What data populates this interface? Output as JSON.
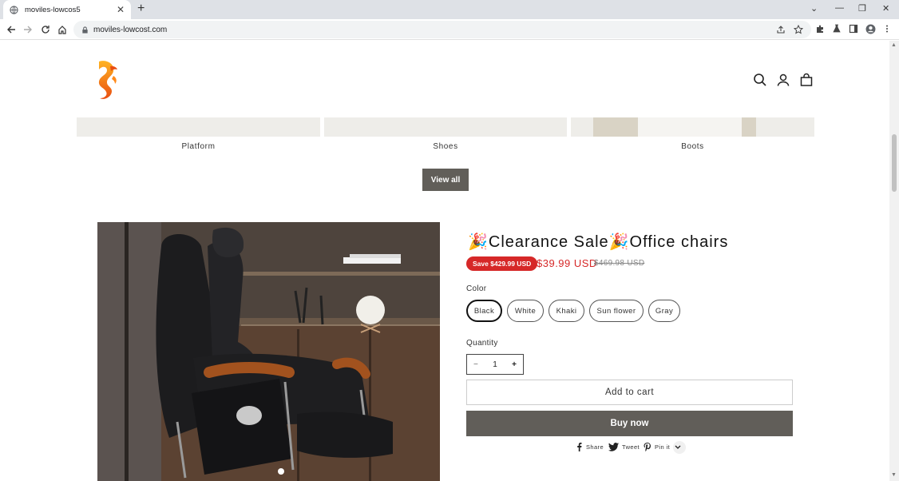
{
  "browser": {
    "tab_title": "moviles-lowcos5",
    "url": "moviles-lowcost.com"
  },
  "header": {
    "icons": [
      "search-icon",
      "account-icon",
      "cart-icon"
    ]
  },
  "categories": [
    {
      "label": "Platform"
    },
    {
      "label": "Shoes"
    },
    {
      "label": "Boots"
    }
  ],
  "view_all_label": "View all",
  "product": {
    "title": "🎉Clearance Sale🎉Office chairs",
    "save_badge": "Save $429.99 USD",
    "price": "$39.99 USD",
    "price_old": "$469.98 USD",
    "color_label": "Color",
    "colors": [
      "Black",
      "White",
      "Khaki",
      "Sun flower",
      "Gray"
    ],
    "selected_color": "Black",
    "quantity_label": "Quantity",
    "quantity": "1",
    "add_to_cart": "Add to cart",
    "buy_now": "Buy now",
    "share": {
      "facebook": "Share",
      "twitter": "Tweet",
      "pinterest": "Pin it"
    }
  },
  "colors": {
    "sale_red": "#d62828",
    "button_gray": "#615e59"
  }
}
